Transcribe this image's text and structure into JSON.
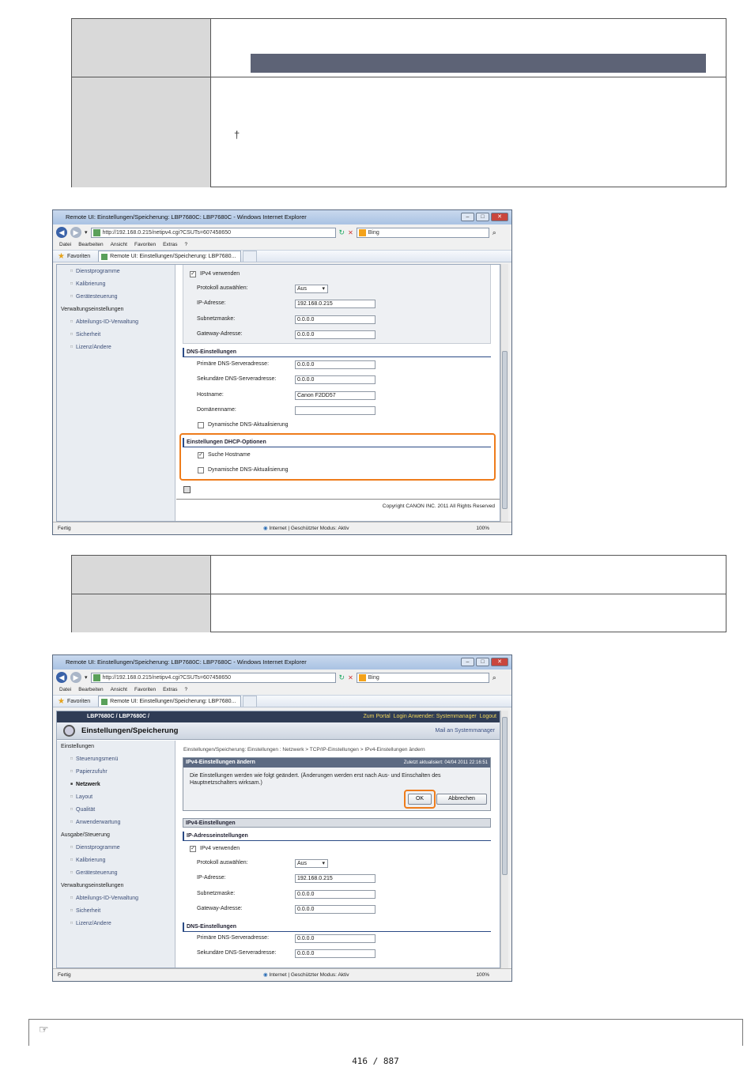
{
  "browser": {
    "title": "Remote UI: Einstellungen/Speicherung: LBP7680C: LBP7680C - Windows Internet Explorer",
    "url": "http://192.168.0.215/netipv4.cgi?CSUTs=607458650",
    "search_engine": "Bing",
    "menu": [
      "Datei",
      "Bearbeiten",
      "Ansicht",
      "Favoriten",
      "Extras",
      "?"
    ],
    "favorites_label": "Favoriten",
    "tab_label": "Remote UI: Einstellungen/Speicherung: LBP7680...",
    "status_left": "Fertig",
    "status_zone": "Internet | Geschützter Modus: Aktiv",
    "zoom": "100%",
    "win_min": "–",
    "win_max": "□",
    "win_close": "✕",
    "nav_back": "◀",
    "nav_fwd": "▶",
    "dropdown": "▾",
    "refresh_icon": "↻",
    "stop_icon": "✕",
    "search_icon": "⌕",
    "star_icon": "★",
    "globe_icon": "◉",
    "pin_glyph": "†",
    "hand_glyph": "☞"
  },
  "sidebar": {
    "einstellungen": "Einstellungen",
    "einstellungen_items": [
      "Steuerungsmenü",
      "Papierzufuhr",
      "Netzwerk",
      "Layout",
      "Qualität",
      "Anwenderwartung"
    ],
    "ausgabe": "Ausgabe/Steuerung",
    "ausgabe_items": [
      "Dienstprogramme",
      "Kalibrierung",
      "Gerätesteuerung"
    ],
    "verwaltung": "Verwaltungseinstellungen",
    "verwaltung_items": [
      "Abteilungs-ID-Verwaltung",
      "Sicherheit",
      "Lizenz/Andere"
    ]
  },
  "form": {
    "ipv4_section": "IPv4-Einstellungen",
    "ip_section": "IP-Adresseinstellungen",
    "ipv4_use": "IPv4 verwenden",
    "protokoll_label": "Protokoll auswählen:",
    "protokoll_value": "Aus",
    "ip_label": "IP-Adresse:",
    "ip_value": "192.168.0.215",
    "subnet_label": "Subnetzmaske:",
    "subnet_value": "0.0.0.0",
    "gateway_label": "Gateway-Adresse:",
    "gateway_value": "0.0.0.0",
    "dns_section": "DNS-Einstellungen",
    "dns1_label": "Primäre DNS-Serveradresse:",
    "dns1_value": "0.0.0.0",
    "dns2_label": "Sekundäre DNS-Serveradresse:",
    "dns2_value": "0.0.0.0",
    "host_label": "Hostname:",
    "host_value": "Canon F2DD57",
    "domain_label": "Domänenname:",
    "domain_value": "",
    "dyn_dns": "Dynamische DNS-Aktualisierung",
    "dhcp_section": "Einstellungen DHCP-Optionen",
    "search_host": "Suche Hostname",
    "dyn_dns2": "Dynamische DNS-Aktualisierung",
    "copyright": "Copyright CANON INC. 2011 All Rights Reserved",
    "check_mark": "✓"
  },
  "screen2": {
    "model": "LBP7680C / LBP7680C /",
    "portal": "Zum Portal",
    "login": "Login Anwender: Systemmanager",
    "logout": "Logout",
    "header_title": "Einstellungen/Speicherung",
    "mail": "Mail an Systemmanager",
    "breadcrumb": "Einstellungen/Speicherung: Einstellungen : Netzwerk > TCP/IP-Einstellungen > IPv4-Einstellungen ändern",
    "dialog_title": "IPv4-Einstellungen ändern",
    "dialog_updated": "Zuletzt aktualisiert: 04/04 2011 22:16:51",
    "dialog_text": "Die Einstellungen werden wie folgt geändert. (Änderungen werden erst nach Aus- und Einschalten des Hauptnetzschalters wirksam.)",
    "ok": "OK",
    "cancel": "Abbrechen"
  },
  "page_number": "416 / 887"
}
